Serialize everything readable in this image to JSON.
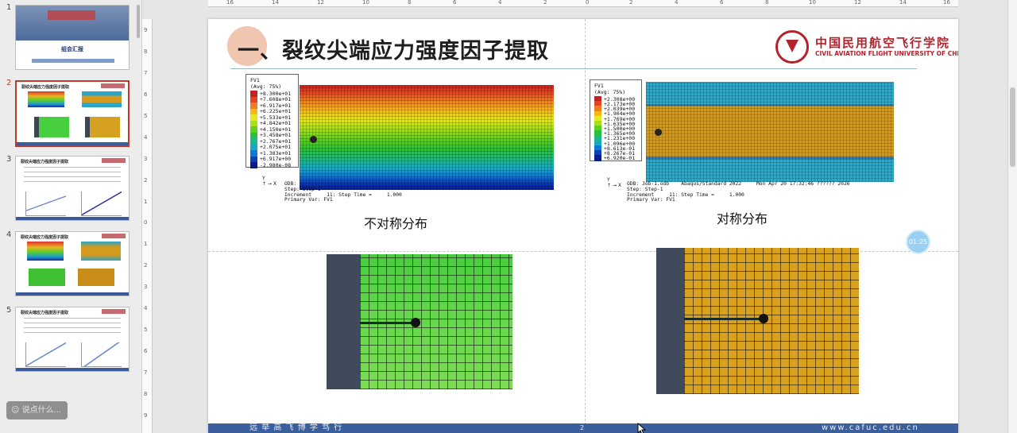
{
  "thumbnails": [
    {
      "num": "1",
      "title": "",
      "subtitle": "组会汇报"
    },
    {
      "num": "2",
      "title": "裂纹尖端应力强度因子提取"
    },
    {
      "num": "3",
      "title": "裂纹尖端应力强度因子提取"
    },
    {
      "num": "4",
      "title": "裂纹尖端应力强度因子提取"
    },
    {
      "num": "5",
      "title": "裂纹尖端应力强度因子提取"
    }
  ],
  "chat_pill": {
    "label": "说点什么..."
  },
  "ruler_numbers": {
    "horizontal": [
      "16",
      "14",
      "12",
      "10",
      "8",
      "6",
      "4",
      "2",
      "0",
      "2",
      "4",
      "6",
      "8",
      "10",
      "12",
      "14",
      "16"
    ],
    "vertical": [
      "9",
      "8",
      "7",
      "6",
      "5",
      "4",
      "3",
      "2",
      "1",
      "0",
      "1",
      "2",
      "3",
      "4",
      "5",
      "6",
      "7",
      "8",
      "9"
    ]
  },
  "slide": {
    "title_prefix": "一、",
    "title": "裂纹尖端应力强度因子提取",
    "logo_cn": "中国民用航空飞行学院",
    "logo_en": "CIVIL AVIATION FLIGHT UNIVERSITY OF CHINA",
    "left_legend": {
      "head": "FV1\n(Avg: 75%)",
      "values": [
        "+8.300e+01",
        "+7.608e+01",
        "+6.917e+01",
        "+6.225e+01",
        "+5.533e+01",
        "+4.842e+01",
        "+4.150e+01",
        "+3.458e+01",
        "+2.767e+01",
        "+2.075e+01",
        "+1.383e+01",
        "+6.917e+00",
        "-2.980e-08"
      ],
      "colors": [
        "#c62121",
        "#e34420",
        "#f07c1e",
        "#f5b81a",
        "#e8e81a",
        "#a8e01c",
        "#5fd01e",
        "#28c23a",
        "#1cb78c",
        "#16a7c9",
        "#1177d6",
        "#0c3fb8",
        "#0a1b8e"
      ]
    },
    "right_legend": {
      "head": "FV1\n(Avg: 75%)",
      "values": [
        "+2.308e+00",
        "+2.173e+00",
        "+2.039e+00",
        "+1.904e+00",
        "+1.769e+00",
        "+1.635e+00",
        "+1.500e+00",
        "+1.365e+00",
        "+1.231e+00",
        "+1.096e+00",
        "+8.613e-01",
        "+8.267e-01",
        "+6.920e-01"
      ],
      "colors": [
        "#c62121",
        "#e34420",
        "#f07c1e",
        "#f5b81a",
        "#e8e81a",
        "#a8e01c",
        "#5fd01e",
        "#28c23a",
        "#1cb78c",
        "#16a7c9",
        "#1177d6",
        "#0c3fb8",
        "#0a1b8e"
      ]
    },
    "left_info": "ODB: \nStep: Step-1\nIncrement     11: Step Time =     1.000\nPrimary Var: FV1",
    "right_info": "ODB: Job-1.odb    Abaqus/Standard 2022     Mon Apr 20 17:32:46 ?????? 2026\nStep: Step-1\nIncrement     11: Step Time =     1.000\nPrimary Var: FV1",
    "caption_left": "不对称分布",
    "caption_right": "对称分布",
    "footer_left": "远 举 高 飞      博 学 笃 行",
    "page_number": "2",
    "footer_right": "www.cafuc.edu.cn",
    "badge_label": "01:25"
  }
}
